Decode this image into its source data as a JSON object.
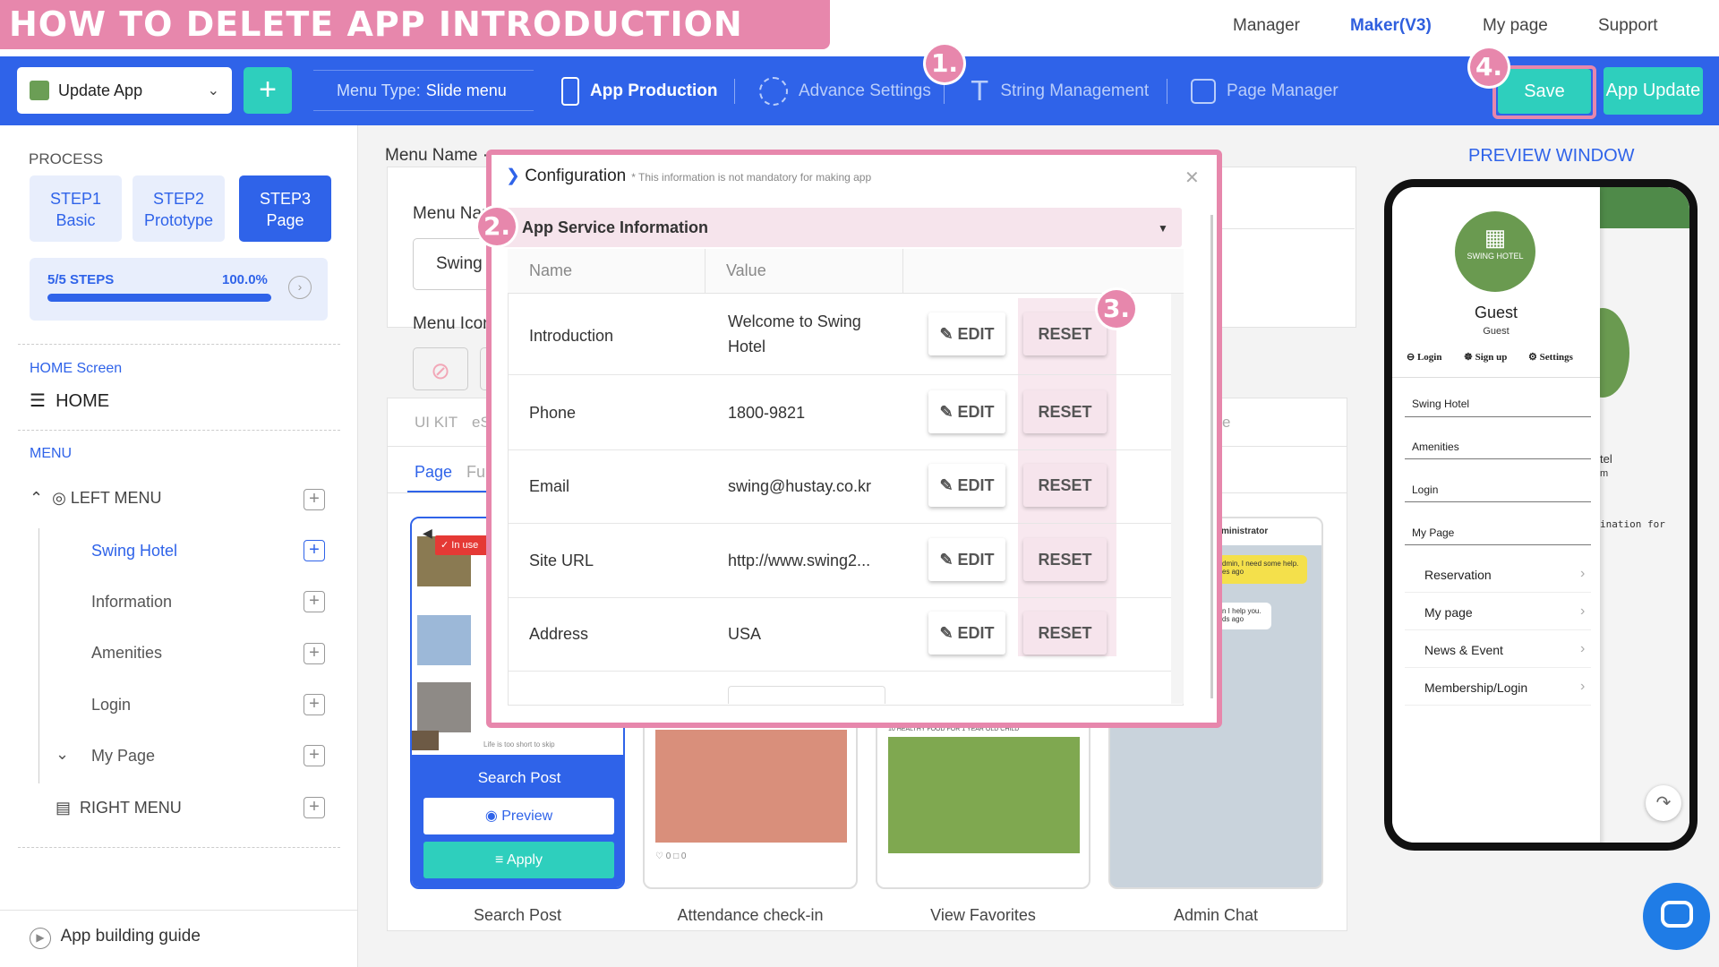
{
  "banner": "HOW TO DELETE APP INTRODUCTION BUTTONS",
  "topnav": [
    "Manager",
    "Maker(V3)",
    "My page",
    "Support"
  ],
  "toolbar": {
    "app_select": "Update App",
    "menu_type_label": "Menu Type:",
    "menu_type_value": "Slide menu",
    "items": [
      "App Production",
      "Advance Settings",
      "String Management",
      "Page Manager"
    ],
    "save": "Save",
    "app_update": "App Update"
  },
  "badges": [
    "1.",
    "2.",
    "3.",
    "4."
  ],
  "sidebar": {
    "process": "PROCESS",
    "steps": [
      {
        "l1": "STEP1",
        "l2": "Basic"
      },
      {
        "l1": "STEP2",
        "l2": "Prototype"
      },
      {
        "l1": "STEP3",
        "l2": "Page"
      }
    ],
    "steps_count": "5/5 STEPS",
    "steps_pct": "100.0%",
    "progress": 1.0,
    "home_screen": "HOME Screen",
    "home": "HOME",
    "menu": "MENU",
    "left_menu": "LEFT MENU",
    "items": [
      "Swing Hotel",
      "Information",
      "Amenities",
      "Login",
      "My Page"
    ],
    "right_menu": "RIGHT MENU",
    "guide": "App building guide"
  },
  "main": {
    "menu_name_top": "Menu Name ·",
    "menu_name": "Menu Nar",
    "input_value": "Swing H",
    "menu_icon": "Menu Icon",
    "tabs": [
      "UI KIT",
      "eS"
    ],
    "subtabs": [
      "Page",
      "Fu"
    ],
    "in_use": "In use",
    "cards": [
      "Search Post",
      "Attendance check-in",
      "View Favorites",
      "Admin Chat"
    ],
    "search_post_title": "Search Post",
    "preview": "Preview",
    "apply": "Apply",
    "card_snippet": "Life is too short to skip",
    "food_caption": "10 HEALTHY FOOD FOR 1 YEAR OLD CHILD",
    "chat_admin": "ministrator",
    "chat_msg1": "dmin, I need some help.",
    "chat_time1": "es ago",
    "chat_msg2": "n I help you.",
    "chat_time2": "ds ago",
    "frag_tel": "tel",
    "frag_m": "m",
    "frag_ination": "ination for",
    "frag_e": "e",
    "counts": [
      "0",
      "0"
    ]
  },
  "modal": {
    "title": "Configuration",
    "subtitle": "* This information is not mandatory for making app",
    "section": "App Service Information",
    "col_name": "Name",
    "col_value": "Value",
    "edit": "EDIT",
    "reset": "RESET",
    "rows": [
      {
        "name": "Introduction",
        "value": "Welcome to Swing Hotel"
      },
      {
        "name": "Phone",
        "value": "1800-9821"
      },
      {
        "name": "Email",
        "value": "swing@hustay.co.kr"
      },
      {
        "name": "Site URL",
        "value": "http://www.swing2..."
      },
      {
        "name": "Address",
        "value": "USA"
      }
    ]
  },
  "preview_window": {
    "title": "PREVIEW WINDOW",
    "logo_text": "SWING HOTEL",
    "guest": "Guest",
    "guest_sub": "Guest",
    "actions": [
      "Login",
      "Sign up",
      "Settings"
    ],
    "menu_plain": [
      "Swing Hotel",
      "Amenities",
      "Login",
      "My Page"
    ],
    "menu_arrow": [
      "Reservation",
      "My page",
      "News & Event",
      "Membership/Login"
    ]
  },
  "colors": {
    "accent": "#2f63e9",
    "teal": "#2ecfbd",
    "pink": "#e787ac"
  }
}
